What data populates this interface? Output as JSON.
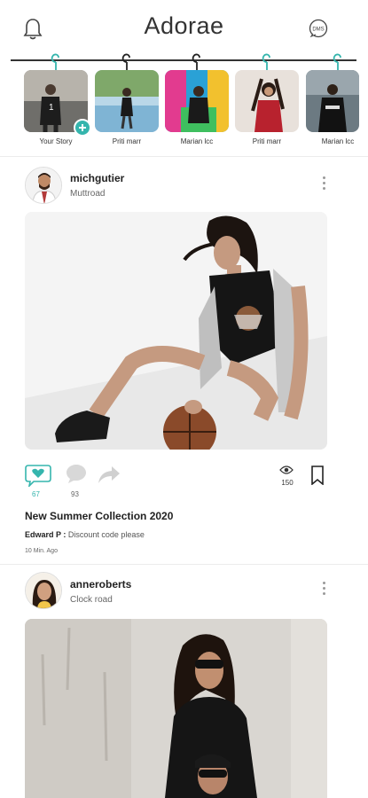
{
  "app": {
    "title": "Adorae"
  },
  "header": {
    "dm_label": "DMS"
  },
  "stories": [
    {
      "label": "Your Story"
    },
    {
      "label": "Priti marr"
    },
    {
      "label": "Marian lcc"
    },
    {
      "label": "Priti marr"
    },
    {
      "label": "Marian lcc"
    }
  ],
  "posts": [
    {
      "username": "michgutier",
      "location": "Muttroad",
      "likes": "67",
      "comments": "93",
      "views": "150",
      "caption_title": "New Summer Collection 2020",
      "comment_user": "Edward P :",
      "comment_text": "Discount code please",
      "timestamp": "10 Min. Ago"
    },
    {
      "username": "anneroberts",
      "location": "Clock road"
    }
  ],
  "colors": {
    "accent": "#35b5ad",
    "text": "#222222",
    "muted": "#666666"
  }
}
